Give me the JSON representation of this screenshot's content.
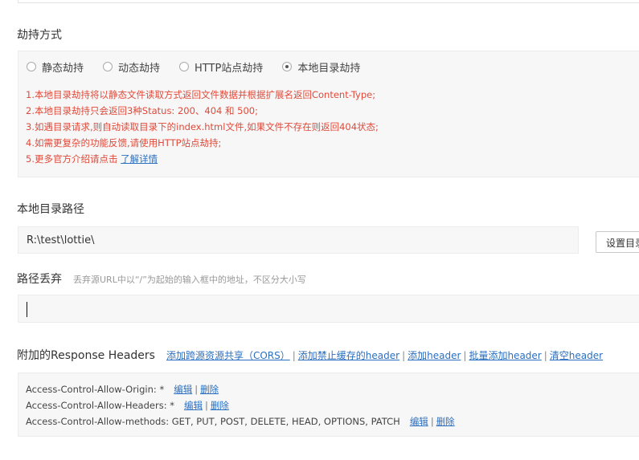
{
  "hijack": {
    "title": "劫持方式",
    "options": [
      {
        "label": "静态劫持",
        "checked": false
      },
      {
        "label": "动态劫持",
        "checked": false
      },
      {
        "label": "HTTP站点劫持",
        "checked": false
      },
      {
        "label": "本地目录劫持",
        "checked": true
      }
    ],
    "notes": [
      "1.本地目录劫持将以静态文件读取方式返回文件数据并根据扩展名返回Content-Type;",
      "2.本地目录劫持只会返回3种Status: 200、404 和 500;",
      "3.如遇目录请求,则自动读取目录下的index.html文件,如果文件不存在则返回404状态;",
      "4.如需更复杂的功能反馈,请使用HTTP站点劫持;",
      "5.更多官方介绍请点击 "
    ],
    "details_link": "了解详情"
  },
  "local_path": {
    "title": "本地目录路径",
    "value": "R:\\test\\lottie\\",
    "button_label": "设置目录"
  },
  "path_discard": {
    "title": "路径丢弃",
    "hint": "丢弃源URL中以“/”为起始的输入框中的地址，不区分大小写",
    "value": ""
  },
  "response_headers": {
    "title": "附加的Response Headers",
    "links": [
      "添加跨源资源共享（CORS）",
      "添加禁止缓存的header",
      "添加header",
      "批量添加header",
      "清空header"
    ],
    "edit_label": "编辑",
    "delete_label": "删除",
    "items": [
      "Access-Control-Allow-Origin: *",
      "Access-Control-Allow-Headers: *",
      "Access-Control-Allow-methods: GET, PUT, POST, DELETE, HEAD, OPTIONS, PATCH"
    ]
  }
}
